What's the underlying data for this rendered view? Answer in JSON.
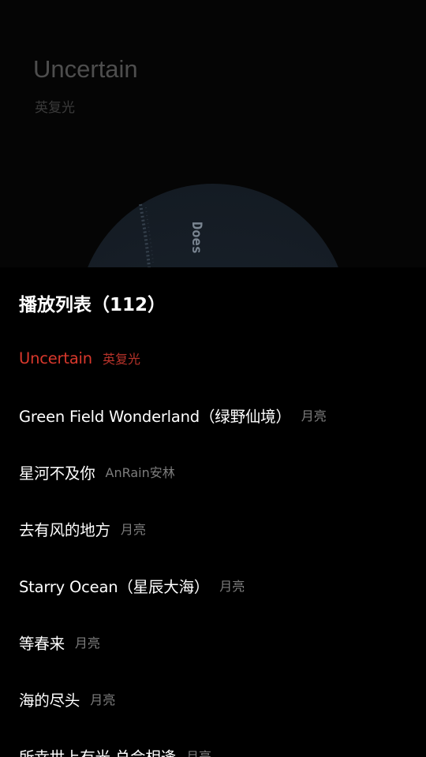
{
  "now_playing": {
    "title": "Uncertain",
    "artist": "英复光",
    "cover_text": "Does"
  },
  "playlist": {
    "title": "播放列表（112）",
    "songs": [
      {
        "title": "Uncertain",
        "artist": "英复光",
        "active": true
      },
      {
        "title": "Green Field Wonderland（绿野仙境）",
        "artist": "月亮",
        "active": false
      },
      {
        "title": "星河不及你",
        "artist": "AnRain安林",
        "active": false
      },
      {
        "title": "去有风的地方",
        "artist": "月亮",
        "active": false
      },
      {
        "title": "Starry Ocean（星辰大海）",
        "artist": "月亮",
        "active": false
      },
      {
        "title": "等春来",
        "artist": "月亮",
        "active": false
      },
      {
        "title": "海的尽头",
        "artist": "月亮",
        "active": false
      },
      {
        "title": "所幸世上有光 总会相逢",
        "artist": "月亮",
        "active": false
      }
    ]
  },
  "colors": {
    "active": "#d9382c",
    "text": "#ffffff",
    "secondary": "#7d7d7d",
    "background": "#000000"
  }
}
